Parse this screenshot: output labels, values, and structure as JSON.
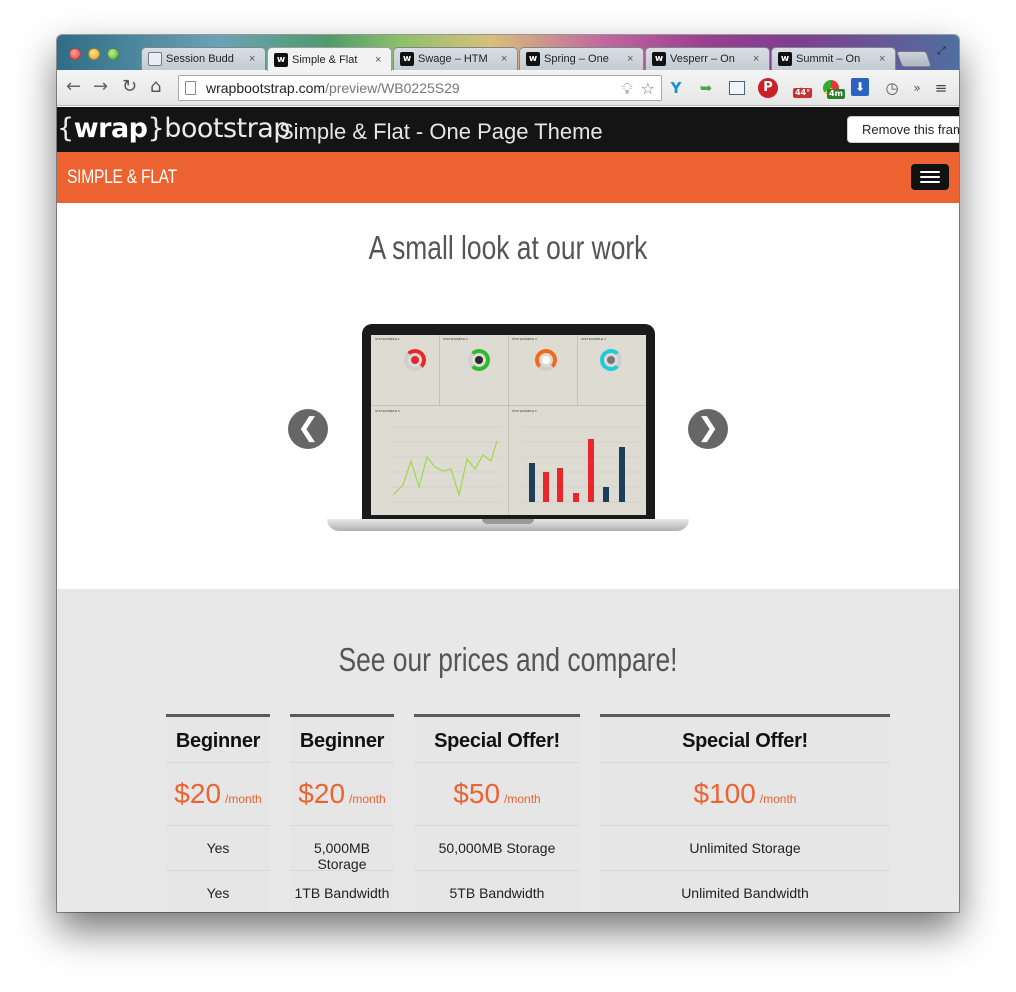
{
  "browser": {
    "tabs": [
      {
        "label": "Session Budd",
        "favicon": "session-buddy-icon",
        "active": false
      },
      {
        "label": "Simple & Flat",
        "favicon": "w",
        "active": true
      },
      {
        "label": "Swage – HTM",
        "favicon": "w",
        "active": false
      },
      {
        "label": "Spring – One",
        "favicon": "w",
        "active": false
      },
      {
        "label": "Vesperr – On",
        "favicon": "w",
        "active": false
      },
      {
        "label": "Summit – On",
        "favicon": "w",
        "active": false
      }
    ],
    "tab_close": "×",
    "url_host": "wrapbootstrap.com",
    "url_path": "/preview/WB0225S29",
    "badges": {
      "weather": "44°",
      "timer": "4m"
    },
    "more_extensions": "»"
  },
  "wrapbar": {
    "logo_brace_open": "{",
    "logo_wrap": "wrap",
    "logo_brace_close": "}",
    "logo_rest": "bootstrap",
    "title": "Simple & Flat - One Page Theme",
    "remove_button": "Remove this frame"
  },
  "navbar": {
    "brand": "SIMPLE & FLAT"
  },
  "work": {
    "title": "A small look at our work",
    "prev": "❮",
    "next": "❯",
    "screen_panels": [
      "STAT EXAMPLE 1",
      "STAT EXAMPLE 2",
      "STAT EXAMPLE 3",
      "STAT EXAMPLE 4",
      "STAT EXAMPLE 5",
      "STAT EXAMPLE 6"
    ]
  },
  "prices": {
    "title": "See our prices and compare!",
    "plans": [
      {
        "name": "Beginner",
        "amount": "$20",
        "period": "/month",
        "features": [
          "Yes",
          "Yes"
        ]
      },
      {
        "name": "Beginner",
        "amount": "$20",
        "period": "/month",
        "features": [
          "5,000MB Storage",
          "1TB Bandwidth"
        ]
      },
      {
        "name": "Special Offer!",
        "amount": "$50",
        "period": "/month",
        "features": [
          "50,000MB Storage",
          "5TB Bandwidth"
        ]
      },
      {
        "name": "Special Offer!",
        "amount": "$100",
        "period": "/month",
        "features": [
          "Unlimited Storage",
          "Unlimited Bandwidth"
        ]
      }
    ]
  },
  "colors": {
    "accent": "#ec6331",
    "wrapbar": "#141414"
  }
}
